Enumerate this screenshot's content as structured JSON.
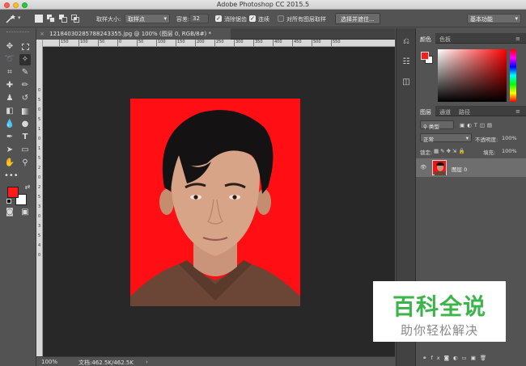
{
  "window": {
    "title": "Adobe Photoshop CC 2015.5"
  },
  "options_bar": {
    "sample_size_label": "取样大小:",
    "sample_size_value": "取样点",
    "tolerance_label": "容差:",
    "tolerance_value": "32",
    "antialias_label": "消除锯齿",
    "contiguous_label": "连续",
    "sample_all_layers_label": "对所有图层取样",
    "select_mask_button": "选择并遮住...",
    "workspace_value": "基本功能"
  },
  "document": {
    "tab_title": "12184030285788243355.jpg @ 100% (图层 0, RGB/8#) *",
    "ruler_h_labels": [
      "150",
      "100",
      "50",
      "0",
      "50",
      "100",
      "150",
      "200",
      "250",
      "300",
      "350",
      "400",
      "450",
      "500",
      "550"
    ],
    "ruler_v_labels": [
      "0",
      "5",
      "0",
      "5",
      "1",
      "0",
      "1",
      "5",
      "2",
      "0",
      "2",
      "5",
      "3",
      "0",
      "3",
      "5",
      "4",
      "0"
    ]
  },
  "status": {
    "zoom": "100%",
    "doc_size": "文档:462.5K/462.5K"
  },
  "color_panel": {
    "tabs": [
      "颜色",
      "色板"
    ],
    "foreground": "#ff1a1a",
    "background": "#ffffff"
  },
  "layers_panel": {
    "tabs": [
      "图层",
      "通道",
      "路径"
    ],
    "filter_label": "类型",
    "blend_mode": "正常",
    "opacity_label": "不透明度:",
    "opacity_value": "100%",
    "lock_label": "锁定:",
    "fill_label": "填充:",
    "fill_value": "100%",
    "layers": [
      {
        "name": "图层 0",
        "visible": true
      }
    ]
  },
  "watermark": {
    "title": "百科全说",
    "subtitle": "助你轻松解决"
  },
  "colors": {
    "accent_red": "#ff0e14",
    "watermark_green": "#3bb44a"
  }
}
